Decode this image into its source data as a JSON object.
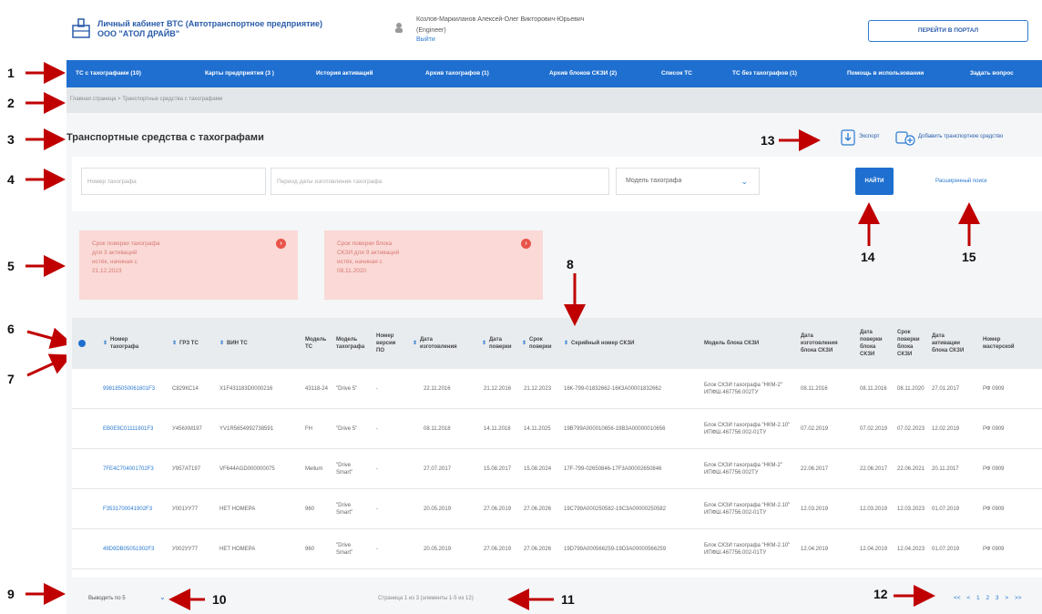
{
  "header": {
    "title": "Личный кабинет ВТС (Автотранспортное предприятие)",
    "org": "ООО \"АТОЛ ДРАЙВ\"",
    "user_name": "Козлов-Маркиланов Алексей-Олег Викторович-Юрьевич",
    "user_role": "(Engineer)",
    "logout": "Выйти",
    "portal_button": "ПЕРЕЙТИ В ПОРТАЛ"
  },
  "nav": [
    "ТС с тахографами (10)",
    "Карты предприятия (3 )",
    "История активаций",
    "Архив тахографов (1)",
    "Архив блоков СКЗИ (2)",
    "Список ТС",
    "ТС без тахографов (1)",
    "Помощь в использовании",
    "Задать вопрос"
  ],
  "breadcrumb": "Главная страница  >  Транспортные средства с тахографами",
  "page_title": "Транспортные средства с тахографами",
  "toolbar": {
    "export": "Экспорт",
    "add": "Добавить транспортное средство"
  },
  "search": {
    "tacho_number_placeholder": "Номер тахографа",
    "period_placeholder": "Период даты изготовления тахографа",
    "model_select": "Модель тахографа",
    "find_button": "НАЙТИ",
    "advanced_link": "Расширенный поиск"
  },
  "alerts": [
    {
      "lines": [
        "Срок поверки тахографа",
        "для 3 активаций",
        "истёк, начиная с",
        "21.12.2023"
      ]
    },
    {
      "lines": [
        "Срок поверки блока",
        "СКЗИ для 9 активаций",
        "истёк, начиная с",
        "08.11.2020"
      ]
    }
  ],
  "table": {
    "headers": {
      "tacho_no": "Номер тахографа",
      "grz": "ГРЗ ТС",
      "vin": "ВИН ТС",
      "vehicle_model": "Модель ТС",
      "tacho_model": "Модель тахографа",
      "po_version": "Номер версии ПО",
      "manufacture_date": "Дата изготовления",
      "verify_date": "Дата поверки",
      "verify_term": "Срок поверки",
      "skzi_serial": "Серийный номер СКЗИ",
      "skzi_model": "Модель блока СКЗИ",
      "skzi_manufacture": "Дата изготовления блока СКЗИ",
      "skzi_verify": "Дата поверки блока СКЗИ",
      "skzi_term": "Срок поверки блока СКЗИ",
      "skzi_activation": "Дата активации блока СКЗИ",
      "workshop": "Номер мастерской"
    },
    "rows": [
      {
        "tacho_no": "998185050061601F3",
        "grz": "С829КС14",
        "vin": "X1F431183D0000216",
        "vehicle_model": "43118-24",
        "tacho_model": "\"Drive 5\"",
        "po_version": "-",
        "manufacture_date": "22.11.2016",
        "verify_date": "21.12.2016",
        "verify_term": "21.12.2023",
        "skzi_serial": "16К-799-01832662-16К3А00001832662",
        "skzi_model": "Блок СКЗИ тахографа \"НКМ-2\" ИПФШ.467756.002ТУ",
        "skzi_manufacture": "08.11.2016",
        "skzi_verify": "08.11.2016",
        "skzi_term": "08.11.2020",
        "skzi_activation": "27.01.2017",
        "workshop": "РФ 0909"
      },
      {
        "tacho_no": "EB0E9C01111801F3",
        "grz": "У456ХМ197",
        "vin": "YV1R5654992738591",
        "vehicle_model": "FH",
        "tacho_model": "\"Drive 5\"",
        "po_version": "-",
        "manufacture_date": "08.11.2018",
        "verify_date": "14.11.2018",
        "verify_term": "14.11.2025",
        "skzi_serial": "19B799A000010656-19B3A00000010656",
        "skzi_model": "Блок СКЗИ тахографа \"НКМ-2.10\" ИПФШ.467756.002-01ТУ",
        "skzi_manufacture": "07.02.2019",
        "skzi_verify": "07.02.2019",
        "skzi_term": "07.02.2023",
        "skzi_activation": "12.02.2019",
        "workshop": "РФ 0909"
      },
      {
        "tacho_no": "7FE4C704001702F3",
        "grz": "У957АТ197",
        "vin": "VF644AGD000000075",
        "vehicle_model": "Mellum",
        "tacho_model": "\"Drive Smart\"",
        "po_version": "-",
        "manufacture_date": "27.07.2017",
        "verify_date": "15.08.2017",
        "verify_term": "15.08.2024",
        "skzi_serial": "17F-799-02650846-17F3A00002650846",
        "skzi_model": "Блок СКЗИ тахографа \"НКМ-2\" ИПФШ.467756.002ТУ",
        "skzi_manufacture": "22.06.2017",
        "skzi_verify": "22.06.2017",
        "skzi_term": "22.06.2021",
        "skzi_activation": "20.11.2017",
        "workshop": "РФ 0909"
      },
      {
        "tacho_no": "F3531700041902F3",
        "grz": "У001УУ77",
        "vin": "НЕТ НОМЕРА",
        "vehicle_model": "960",
        "tacho_model": "\"Drive Smart\"",
        "po_version": "-",
        "manufacture_date": "20.05.2019",
        "verify_date": "27.06.2019",
        "verify_term": "27.06.2026",
        "skzi_serial": "19C799A000250582-19C3A00000250582",
        "skzi_model": "Блок СКЗИ тахографа \"НКМ-2.10\" ИПФШ.467756.002-01ТУ",
        "skzi_manufacture": "12.03.2019",
        "skzi_verify": "12.03.2019",
        "skzi_term": "12.03.2023",
        "skzi_activation": "01.07.2019",
        "workshop": "РФ 0909"
      },
      {
        "tacho_no": "49D9DB05051902F3",
        "grz": "У002УУ77",
        "vin": "НЕТ НОМЕРА",
        "vehicle_model": "960",
        "tacho_model": "\"Drive Smart\"",
        "po_version": "-",
        "manufacture_date": "20.05.2019",
        "verify_date": "27.06.2019",
        "verify_term": "27.06.2026",
        "skzi_serial": "19D799A000566259-19D3A00000566259",
        "skzi_model": "Блок СКЗИ тахографа \"НКМ-2.10\" ИПФШ.467756.002-01ТУ",
        "skzi_manufacture": "12.04.2019",
        "skzi_verify": "12.04.2019",
        "skzi_term": "12.04.2023",
        "skzi_activation": "01.07.2019",
        "workshop": "РФ 0909"
      }
    ]
  },
  "footer": {
    "per_page": "Выводить по 5",
    "page_info": "Страница 1 из 3 (элементы 1-5 из 12)",
    "pager": [
      "<<",
      "<",
      "1",
      "2",
      "3",
      ">",
      ">>"
    ]
  },
  "callouts": [
    "1",
    "2",
    "3",
    "4",
    "5",
    "6",
    "7",
    "8",
    "9",
    "10",
    "11",
    "12",
    "13",
    "14",
    "15"
  ],
  "colors": {
    "accent": "#1f6fd0",
    "arrow": "#c00000",
    "alert_bg": "#fad9d6"
  }
}
